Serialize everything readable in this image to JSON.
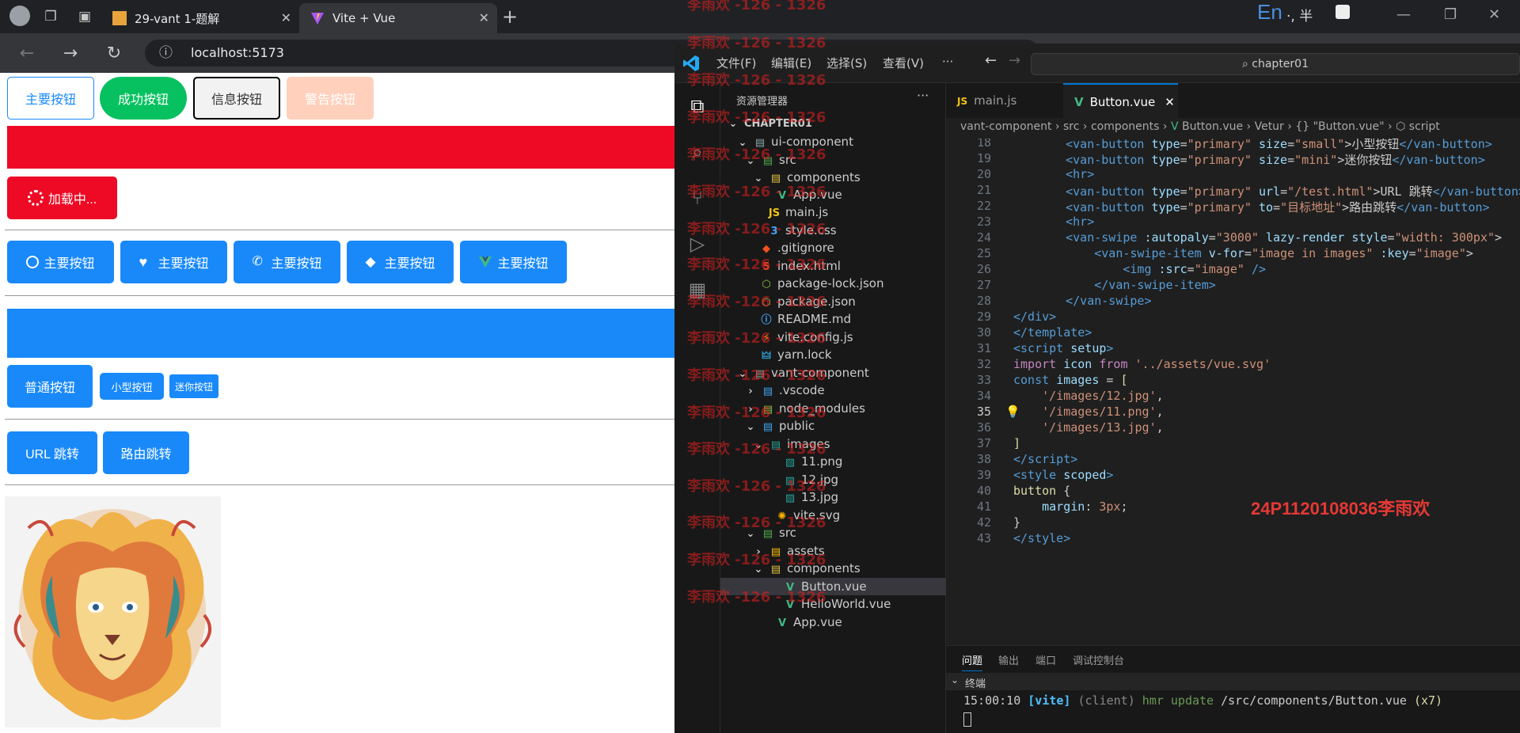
{
  "browser": {
    "tabs": [
      {
        "title": "29-vant 1-题解"
      },
      {
        "title": "Vite + Vue"
      }
    ],
    "url": "localhost:5173",
    "ime": {
      "en": "En",
      "mode": "·, 半"
    }
  },
  "page": {
    "row1": [
      "主要按钮",
      "成功按钮",
      "信息按钮",
      "警告按钮"
    ],
    "loading": "加载中...",
    "icon_buttons": [
      "主要按钮",
      "主要按钮",
      "主要按钮",
      "主要按钮",
      "主要按钮"
    ],
    "sizes": [
      "普通按钮",
      "小型按钮",
      "迷你按钮"
    ],
    "links": [
      "URL 跳转",
      "路由跳转"
    ],
    "colors": {
      "primary": "#1989fa",
      "success": "#07c160",
      "danger": "#ee0a24",
      "warning": "#ff976a"
    }
  },
  "vscode": {
    "menus": [
      "文件(F)",
      "编辑(E)",
      "选择(S)",
      "查看(V)",
      "···"
    ],
    "search": "chapter01",
    "explorer_title": "资源管理器",
    "tree": [
      {
        "label": "CHAPTER01"
      },
      {
        "label": "ui-component"
      },
      {
        "label": "src"
      },
      {
        "label": "components"
      },
      {
        "label": "App.vue"
      },
      {
        "label": "main.js"
      },
      {
        "label": "style.css"
      },
      {
        "label": ".gitignore"
      },
      {
        "label": "index.html"
      },
      {
        "label": "package-lock.json"
      },
      {
        "label": "package.json"
      },
      {
        "label": "README.md"
      },
      {
        "label": "vite.config.js"
      },
      {
        "label": "yarn.lock"
      },
      {
        "label": "vant-component"
      },
      {
        "label": ".vscode"
      },
      {
        "label": "node_modules"
      },
      {
        "label": "public"
      },
      {
        "label": "images"
      },
      {
        "label": "11.png"
      },
      {
        "label": "12.jpg"
      },
      {
        "label": "13.jpg"
      },
      {
        "label": "vite.svg"
      },
      {
        "label": "src"
      },
      {
        "label": "assets"
      },
      {
        "label": "components"
      },
      {
        "label": "Button.vue"
      },
      {
        "label": "HelloWorld.vue"
      },
      {
        "label": "App.vue"
      }
    ],
    "editor_tabs": [
      "main.js",
      "Button.vue"
    ],
    "breadcrumb": [
      "vant-component",
      "src",
      "components",
      "Button.vue",
      "Vetur",
      "{} \"Button.vue\"",
      "script"
    ],
    "line_numbers": [
      "18",
      "19",
      "20",
      "21",
      "22",
      "23",
      "24",
      "25",
      "26",
      "27",
      "28",
      "29",
      "30",
      "31",
      "32",
      "33",
      "34",
      "35",
      "36",
      "37",
      "38",
      "39",
      "40",
      "41",
      "42",
      "43"
    ],
    "overlay_name": "24P1120108036李雨欢",
    "panel_tabs": [
      "问题",
      "输出",
      "端口",
      "调试控制台"
    ],
    "terminal_label": "终端",
    "terminal": {
      "time": "15:00:10",
      "tag": "[vite]",
      "client": "(client)",
      "msg": "hmr update",
      "path": "/src/components/Button.vue",
      "count": "(x7)"
    }
  },
  "watermark": "李雨欢 -126 - 1326"
}
